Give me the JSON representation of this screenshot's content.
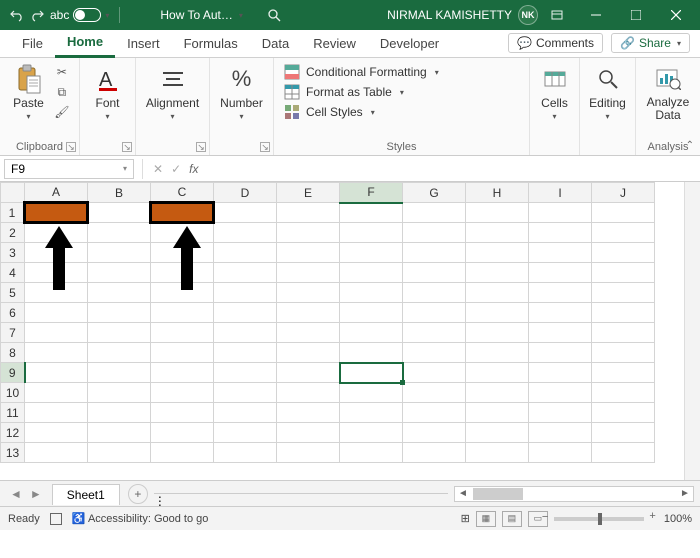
{
  "titlebar": {
    "autosave_label": "abc",
    "doc_title": "How To Aut…",
    "user_name": "NIRMAL KAMISHETTY",
    "user_initials": "NK"
  },
  "tabs": {
    "file": "File",
    "home": "Home",
    "insert": "Insert",
    "formulas": "Formulas",
    "data": "Data",
    "review": "Review",
    "developer": "Developer",
    "comments": "Comments",
    "share": "Share"
  },
  "ribbon": {
    "clipboard": {
      "paste": "Paste",
      "label": "Clipboard"
    },
    "font": {
      "btn": "Font"
    },
    "alignment": {
      "btn": "Alignment"
    },
    "number": {
      "btn": "Number"
    },
    "styles": {
      "cond": "Conditional Formatting",
      "table": "Format as Table",
      "cellstyles": "Cell Styles",
      "label": "Styles"
    },
    "cells": {
      "btn": "Cells"
    },
    "editing": {
      "btn": "Editing"
    },
    "analysis": {
      "btn": "Analyze Data",
      "label": "Analysis"
    }
  },
  "formula_bar": {
    "name_box": "F9",
    "formula": ""
  },
  "grid": {
    "columns": [
      "A",
      "B",
      "C",
      "D",
      "E",
      "F",
      "G",
      "H",
      "I",
      "J"
    ],
    "rows": [
      "1",
      "2",
      "3",
      "4",
      "5",
      "6",
      "7",
      "8",
      "9",
      "10",
      "11",
      "12",
      "13"
    ],
    "highlighted": [
      "A1",
      "C1"
    ],
    "selected": "F9"
  },
  "sheets": {
    "active": "Sheet1"
  },
  "status": {
    "ready": "Ready",
    "accessibility": "Accessibility: Good to go",
    "zoom": "100%"
  }
}
